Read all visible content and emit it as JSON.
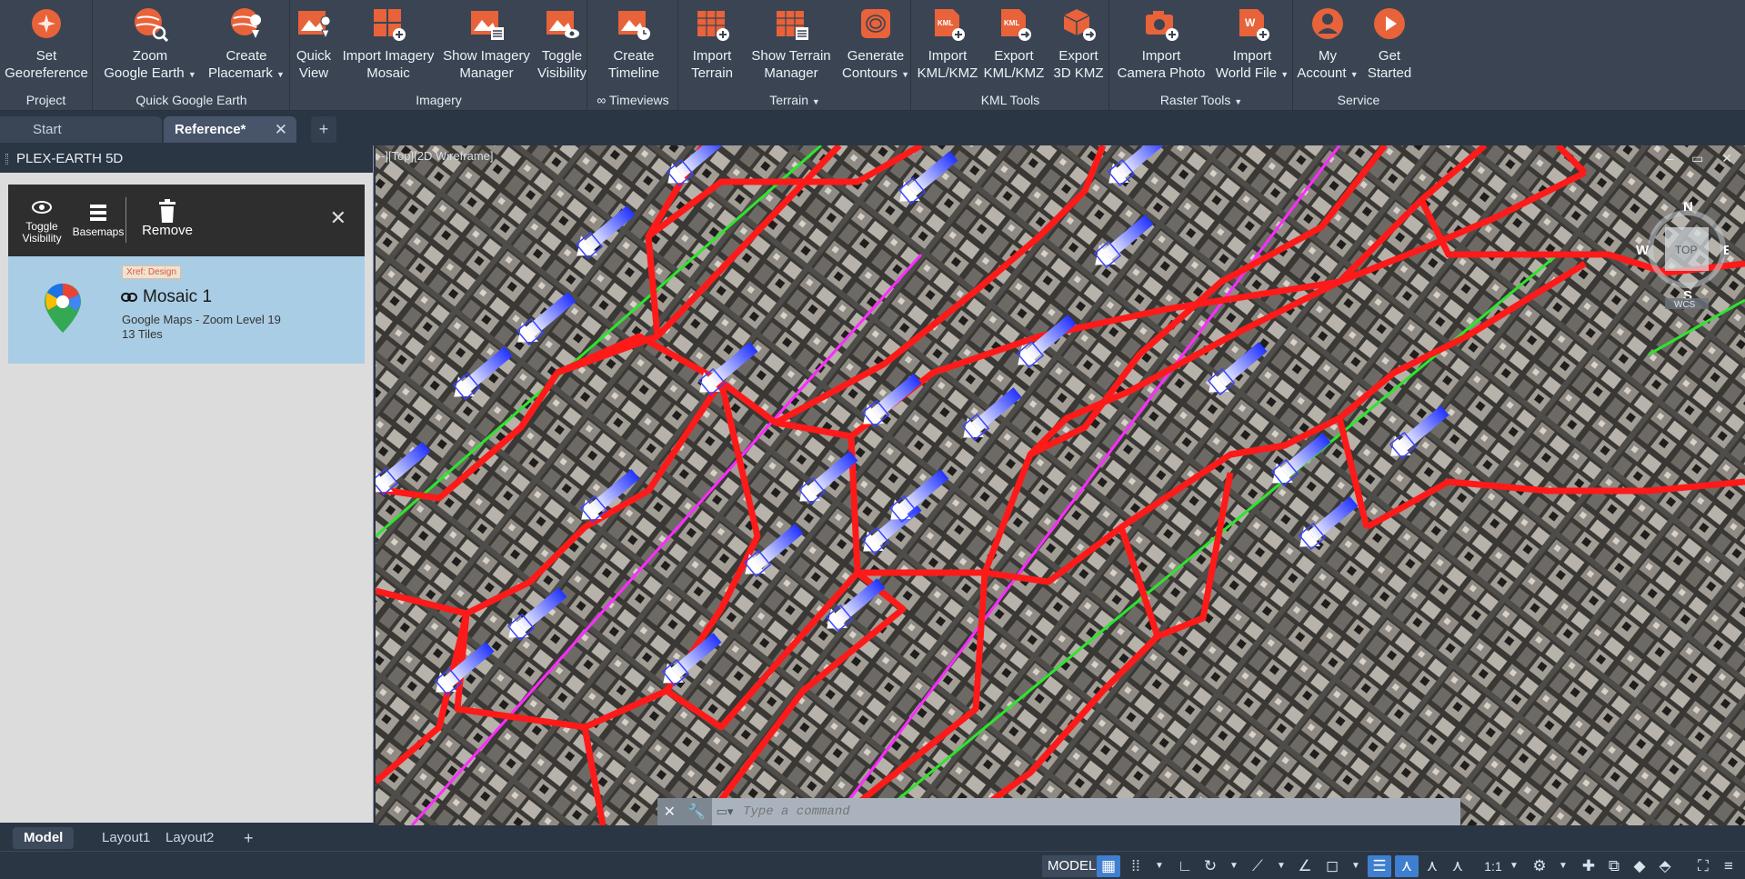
{
  "ribbon": {
    "groups": [
      {
        "title": "Project",
        "buttons": [
          {
            "label": "Set\nGeoreference",
            "icon": "georeference-icon"
          }
        ]
      },
      {
        "title": "Quick Google Earth",
        "buttons": [
          {
            "label": "Zoom\nGoogle Earth",
            "icon": "zoom-google-earth-icon"
          },
          {
            "label": "Create\nPlacemark",
            "icon": "create-placemark-icon"
          }
        ]
      },
      {
        "title": "Imagery",
        "buttons": [
          {
            "label": "Quick\nView",
            "icon": "quick-view-icon"
          },
          {
            "label": "Import Imagery\nMosaic",
            "icon": "import-imagery-mosaic-icon"
          },
          {
            "label": "Show Imagery\nManager",
            "icon": "imagery-manager-icon"
          },
          {
            "label": "Toggle\nVisibility",
            "icon": "toggle-visibility-icon"
          }
        ]
      },
      {
        "title": "∞ Timeviews",
        "buttons": [
          {
            "label": "Create\nTimeline",
            "icon": "create-timeline-icon"
          }
        ]
      },
      {
        "title": "Terrain",
        "buttons": [
          {
            "label": "Import\nTerrain",
            "icon": "import-terrain-icon"
          },
          {
            "label": "Show Terrain\nManager",
            "icon": "terrain-manager-icon"
          },
          {
            "label": "Generate\nContours",
            "icon": "generate-contours-icon"
          }
        ]
      },
      {
        "title": "KML Tools",
        "buttons": [
          {
            "label": "Import\nKML/KMZ",
            "icon": "import-kml-icon"
          },
          {
            "label": "Export\nKML/KMZ",
            "icon": "export-kml-icon"
          },
          {
            "label": "Export\n3D KMZ",
            "icon": "export-3d-kmz-icon"
          }
        ]
      },
      {
        "title": "Raster Tools",
        "buttons": [
          {
            "label": "Import\nCamera Photo",
            "icon": "import-camera-photo-icon"
          },
          {
            "label": "Import\nWorld File",
            "icon": "import-world-file-icon"
          }
        ]
      },
      {
        "title": "Service",
        "buttons": [
          {
            "label": "My\nAccount",
            "icon": "my-account-icon"
          },
          {
            "label": "Get\nStarted",
            "icon": "get-started-icon"
          }
        ]
      }
    ]
  },
  "tabs": {
    "start": "Start",
    "reference": "Reference*",
    "close": "✕",
    "add": "+"
  },
  "panel": {
    "title": "PLEX-EARTH 5D",
    "toolbar": {
      "toggle_visibility": "Toggle\nVisibility",
      "basemaps": "Basemaps",
      "remove": "Remove",
      "close": "✕"
    },
    "item": {
      "badge": "Xref: Design",
      "title": "Mosaic 1",
      "subtitle": "Google Maps - Zoom Level 19",
      "tiles": "13 Tiles"
    }
  },
  "viewport": {
    "label": "-][Top][2D Wireframe]",
    "window_controls": "– ▭ ✕",
    "viewcube": {
      "north": "N",
      "south": "S",
      "east": "E",
      "west": "W",
      "face": "TOP",
      "wcs": "WCS"
    }
  },
  "command": {
    "placeholder": "Type a command",
    "close": "✕",
    "tool": "🔧"
  },
  "layout_tabs": {
    "model": "Model",
    "layout1": "Layout1",
    "layout2": "Layout2",
    "add": "+"
  },
  "status": {
    "model": "MODEL",
    "scale": "1:1"
  },
  "colors": {
    "accent_orange": "#e8623a",
    "road_red": "#ff1a1a",
    "pipe_green": "#2ee52e",
    "pipe_magenta": "#ff2bff",
    "arrow_blue": "#3a44ff",
    "selected_item": "#a9cde4"
  }
}
